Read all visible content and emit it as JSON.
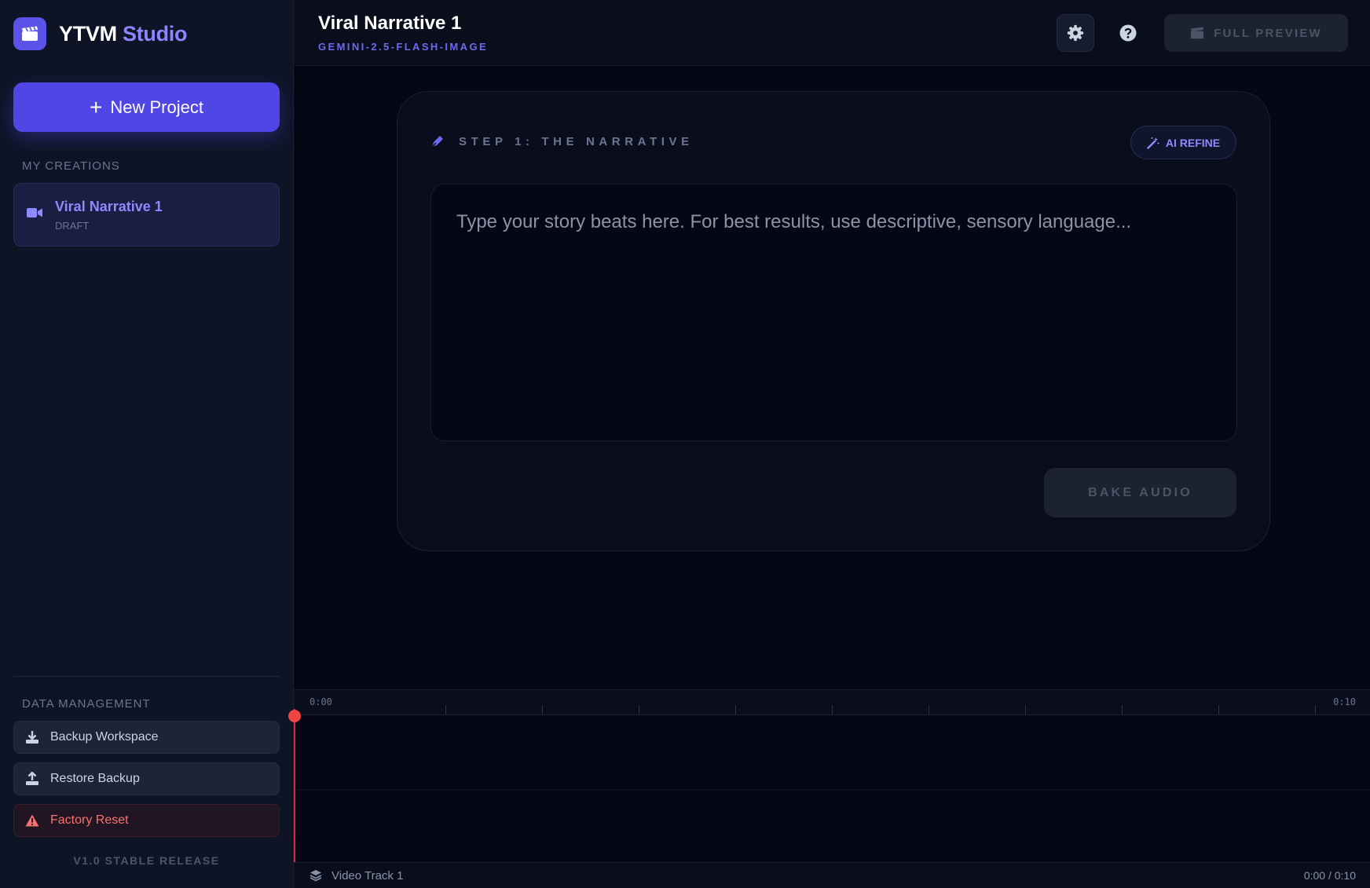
{
  "brand": {
    "name": "YTVM",
    "suffix": "Studio",
    "logo_icon": "clapperboard-icon"
  },
  "sidebar": {
    "new_project_label": "New Project",
    "creations_label": "MY CREATIONS",
    "projects": [
      {
        "title": "Viral Narrative 1",
        "status": "DRAFT",
        "icon": "video-camera-icon"
      }
    ],
    "data_management_label": "DATA MANAGEMENT",
    "backup_label": "Backup Workspace",
    "restore_label": "Restore Backup",
    "reset_label": "Factory Reset",
    "version": "V1.0 STABLE RELEASE"
  },
  "header": {
    "title": "Viral Narrative 1",
    "model": "GEMINI-2.5-FLASH-IMAGE",
    "preview_label": "FULL PREVIEW"
  },
  "editor": {
    "step_title": "STEP 1: THE NARRATIVE",
    "refine_label": "AI REFINE",
    "story_value": "",
    "story_placeholder": "Type your story beats here. For best results, use descriptive, sensory language...",
    "bake_label": "BAKE AUDIO"
  },
  "timeline": {
    "start_label": "0:00",
    "end_label": "0:10",
    "track_name": "Video Track 1",
    "time_display": "0:00 / 0:10",
    "playhead_position": 0
  },
  "colors": {
    "accent": "#4f46e5",
    "accent_text": "#8e8bff",
    "danger": "#f87171",
    "playhead": "#ef4444"
  }
}
